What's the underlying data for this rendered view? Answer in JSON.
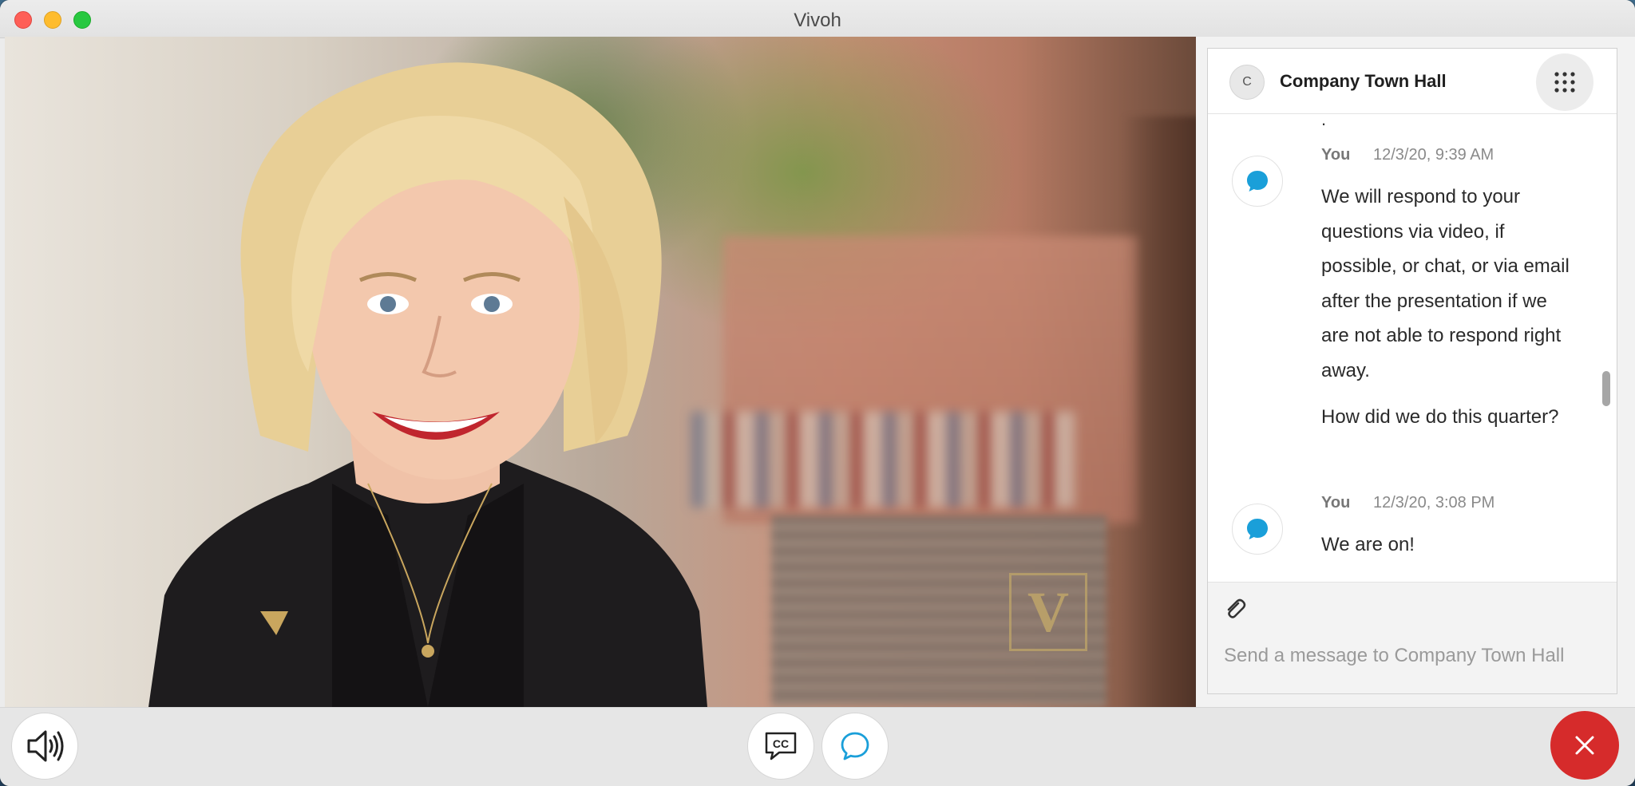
{
  "window": {
    "title": "Vivoh"
  },
  "video": {
    "logo_text": "V"
  },
  "chat": {
    "avatar_initial": "C",
    "title": "Company Town Hall",
    "fragment": ".",
    "messages": [
      {
        "author": "You",
        "time": "12/3/20, 9:39 AM",
        "paragraphs": [
          "We will respond to your questions via video, if possible, or chat, or via email after the presentation if we are not able to respond right away.",
          "How did we do this quarter?"
        ]
      },
      {
        "author": "You",
        "time": "12/3/20, 3:08 PM",
        "paragraphs": [
          "We are on!"
        ]
      }
    ],
    "composer": {
      "placeholder": "Send a message to Company Town Hall"
    }
  },
  "colors": {
    "accent_blue": "#1a9fd9",
    "leave_red": "#d62b2b"
  },
  "icons": {
    "volume": "speaker-icon",
    "captions": "cc-icon",
    "chat": "chat-bubble-icon",
    "leave": "close-icon",
    "attach": "paperclip-icon",
    "menu": "grid-dots-icon",
    "scroll": "chevron-down-icon"
  }
}
